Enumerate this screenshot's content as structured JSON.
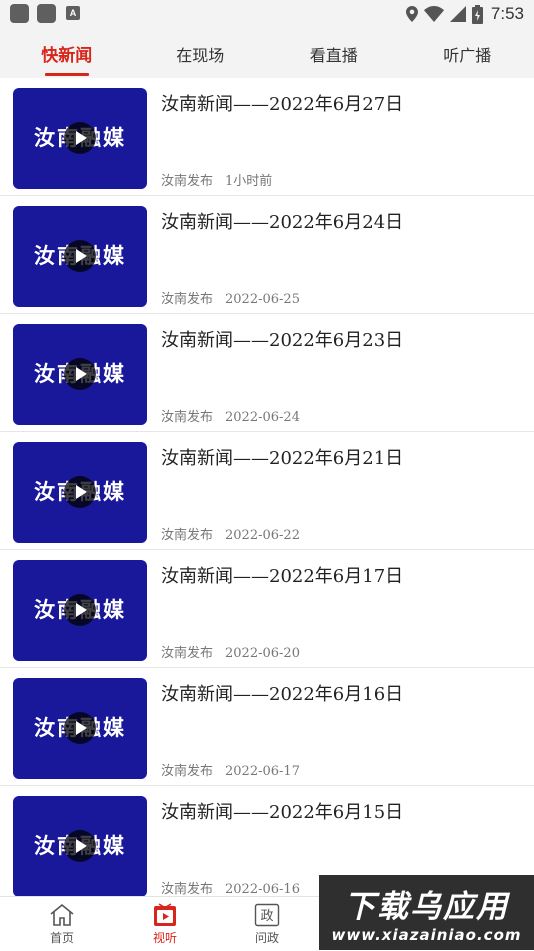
{
  "status_bar": {
    "notif_icon_a": "rounded-square-icon",
    "notif_icon_b": "rounded-square-icon",
    "notif_badge": "A",
    "time": "7:53"
  },
  "tabs": [
    {
      "label": "快新闻",
      "active": true
    },
    {
      "label": "在现场",
      "active": false
    },
    {
      "label": "看直播",
      "active": false
    },
    {
      "label": "听广播",
      "active": false
    }
  ],
  "thumbnail_text": "汝南融媒",
  "items": [
    {
      "title": "汝南新闻——2022年6月27日",
      "source": "汝南发布",
      "time": "1小时前"
    },
    {
      "title": "汝南新闻——2022年6月24日",
      "source": "汝南发布",
      "time": "2022-06-25"
    },
    {
      "title": "汝南新闻——2022年6月23日",
      "source": "汝南发布",
      "time": "2022-06-24"
    },
    {
      "title": "汝南新闻——2022年6月21日",
      "source": "汝南发布",
      "time": "2022-06-22"
    },
    {
      "title": "汝南新闻——2022年6月17日",
      "source": "汝南发布",
      "time": "2022-06-20"
    },
    {
      "title": "汝南新闻——2022年6月16日",
      "source": "汝南发布",
      "time": "2022-06-17"
    },
    {
      "title": "汝南新闻——2022年6月15日",
      "source": "汝南发布",
      "time": "2022-06-16"
    }
  ],
  "bottom_nav": {
    "home": "首页",
    "video": "视听",
    "gov": "问政",
    "gov_icon_char": "政"
  },
  "watermark": {
    "line1": "下载乌应用",
    "line2": "www.xiazainiao.com"
  },
  "colors": {
    "accent": "#d7261b",
    "thumbnail_bg": "#19189a"
  }
}
